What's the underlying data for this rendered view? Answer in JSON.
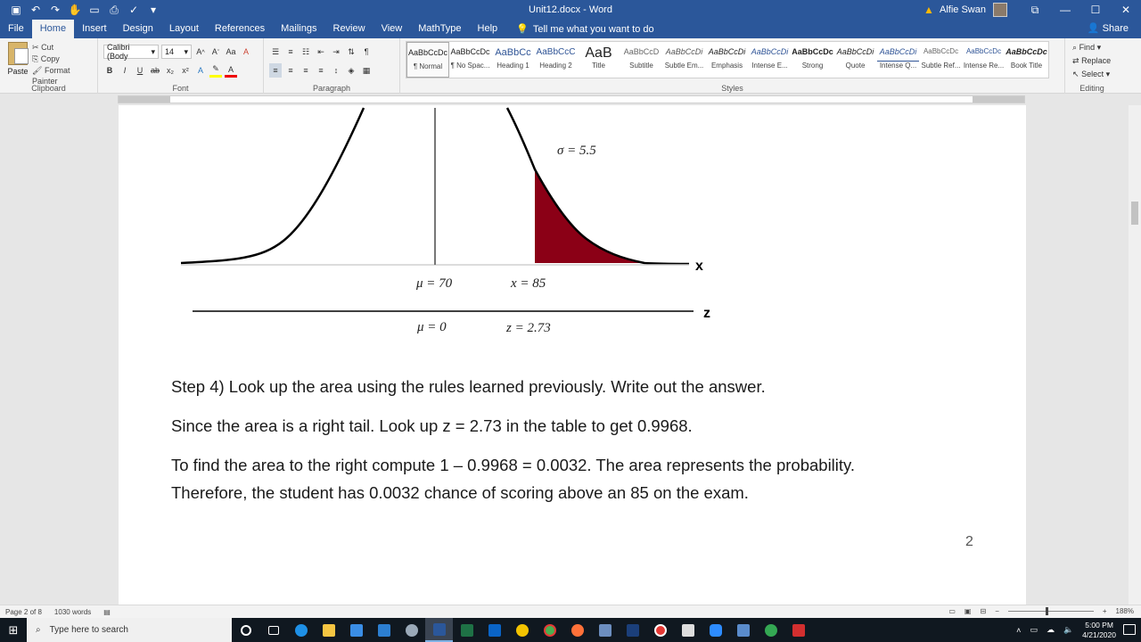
{
  "titlebar": {
    "doc_title": "Unit12.docx - Word",
    "user_name": "Alfie Swan",
    "restore_glyph": "⧉",
    "minimize_glyph": "—",
    "maximize_glyph": "☐",
    "close_glyph": "✕"
  },
  "tabs": [
    "File",
    "Home",
    "Insert",
    "Design",
    "Layout",
    "References",
    "Mailings",
    "Review",
    "View",
    "MathType",
    "Help"
  ],
  "tellme": "Tell me what you want to do",
  "share": "Share",
  "clipboard": {
    "paste": "Paste",
    "cut": "Cut",
    "copy": "Copy",
    "format_painter": "Format Painter",
    "label": "Clipboard"
  },
  "font": {
    "name": "Calibri (Body",
    "size": "14",
    "label": "Font"
  },
  "paragraph": {
    "label": "Paragraph"
  },
  "styles": {
    "label": "Styles",
    "items": [
      {
        "preview": "AaBbCcDc",
        "name": "¶ Normal"
      },
      {
        "preview": "AaBbCcDc",
        "name": "¶ No Spac..."
      },
      {
        "preview": "AaBbCc",
        "name": "Heading 1"
      },
      {
        "preview": "AaBbCcC",
        "name": "Heading 2"
      },
      {
        "preview": "AaB",
        "name": "Title"
      },
      {
        "preview": "AaBbCcD",
        "name": "Subtitle"
      },
      {
        "preview": "AaBbCcDi",
        "name": "Subtle Em..."
      },
      {
        "preview": "AaBbCcDi",
        "name": "Emphasis"
      },
      {
        "preview": "AaBbCcDi",
        "name": "Intense E..."
      },
      {
        "preview": "AaBbCcDc",
        "name": "Strong"
      },
      {
        "preview": "AaBbCcDi",
        "name": "Quote"
      },
      {
        "preview": "AaBbCcDi",
        "name": "Intense Q..."
      },
      {
        "preview": "AaBbCcDc",
        "name": "Subtle Ref..."
      },
      {
        "preview": "AaBbCcDc",
        "name": "Intense Re..."
      },
      {
        "preview": "AaBbCcDc",
        "name": "Book Title"
      }
    ]
  },
  "editing": {
    "find": "Find",
    "replace": "Replace",
    "select": "Select",
    "label": "Editing"
  },
  "figure": {
    "sigma_label": "σ = 5.5",
    "mu_label": "μ = 70",
    "x_label": "x = 85",
    "x_axis": "x",
    "mu0_label": "μ = 0",
    "z_label": "z = 2.73",
    "z_axis": "z",
    "shade_color": "#8b0016"
  },
  "document": {
    "paragraphs": [
      "Step 4) Look up the area using the rules learned previously. Write out the answer.",
      "Since the area is a right tail. Look up z = 2.73 in the table to get 0.9968.",
      "To find the area to the right compute 1 – 0.9968 = 0.0032. The area represents the probability.",
      "Therefore, the student has 0.0032 chance of scoring above an 85 on the exam."
    ],
    "page_number": "2"
  },
  "status": {
    "page": "Page 2 of 8",
    "words": "1030 words",
    "zoom": "188%"
  },
  "taskbar": {
    "search_placeholder": "Type here to search",
    "time": "5:00 PM",
    "date": "4/21/2020"
  },
  "colors": {
    "word_blue": "#2b579a",
    "taskbar": "#101820"
  }
}
